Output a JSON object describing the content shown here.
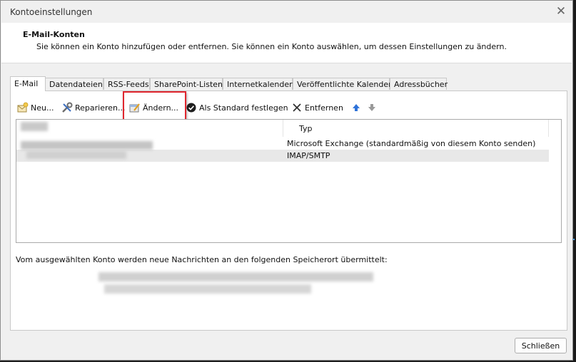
{
  "window": {
    "title": "Kontoeinstellungen",
    "close_glyph": "✕"
  },
  "header": {
    "title": "E-Mail-Konten",
    "description": "Sie können ein Konto hinzufügen oder entfernen. Sie können ein Konto auswählen, um dessen Einstellungen zu ändern."
  },
  "tabs": [
    {
      "label": "E-Mail",
      "active": true
    },
    {
      "label": "Datendateien"
    },
    {
      "label": "RSS-Feeds"
    },
    {
      "label": "SharePoint-Listen"
    },
    {
      "label": "Internetkalender"
    },
    {
      "label": "Veröffentlichte Kalender"
    },
    {
      "label": "Adressbücher"
    }
  ],
  "toolbar": {
    "new": {
      "label": "Neu...",
      "icon": "new-account-icon"
    },
    "repair": {
      "label": "Reparieren...",
      "icon": "repair-icon"
    },
    "change": {
      "label": "Ändern...",
      "icon": "change-icon"
    },
    "set_default": {
      "label": "Als Standard festlegen",
      "icon": "checkmark-icon"
    },
    "remove": {
      "label": "Entfernen",
      "icon": "delete-x-icon"
    },
    "up": {
      "icon": "arrow-up-icon"
    },
    "down": {
      "icon": "arrow-down-icon"
    }
  },
  "accounts": {
    "column_type": "Typ",
    "rows": [
      {
        "type": "Microsoft Exchange (standardmäßig von diesem Konto senden)"
      },
      {
        "type": "IMAP/SMTP",
        "selected": true
      }
    ]
  },
  "delivery": {
    "text": "Vom ausgewählten Konto werden neue Nachrichten an den folgenden Speicherort übermittelt:"
  },
  "footer": {
    "close_label": "Schließen"
  },
  "colors": {
    "highlight": "#e0262e",
    "arrow_up": "#2f73d9",
    "arrow_down": "#9a9a9a"
  }
}
